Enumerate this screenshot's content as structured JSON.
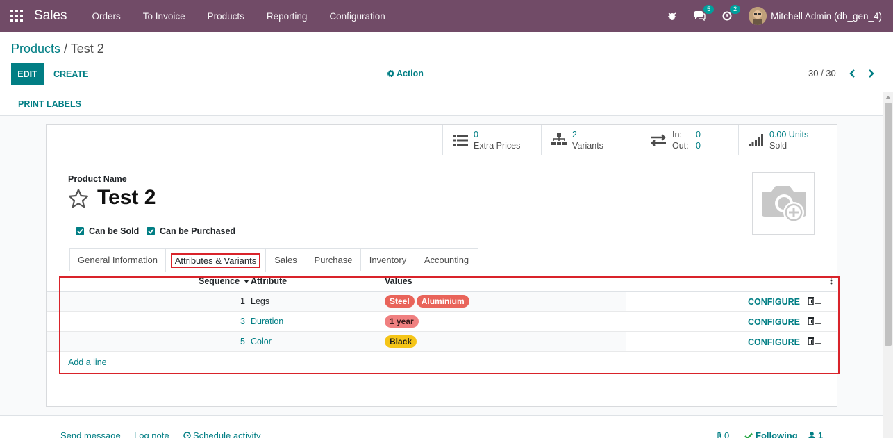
{
  "app": {
    "title": "Sales"
  },
  "menu": [
    "Orders",
    "To Invoice",
    "Products",
    "Reporting",
    "Configuration"
  ],
  "systray": {
    "messages_count": "5",
    "activities_count": "2",
    "user_name": "Mitchell Admin (db_gen_4)"
  },
  "breadcrumb": {
    "parent": "Products",
    "separator": " / ",
    "current": "Test 2"
  },
  "buttons": {
    "edit": "EDIT",
    "create": "CREATE",
    "action": "Action",
    "print_labels": "PRINT LABELS"
  },
  "pager": {
    "value": "30 / 30"
  },
  "stats": {
    "extra_prices": {
      "value": "0",
      "label": "Extra Prices"
    },
    "variants": {
      "value": "2",
      "label": "Variants"
    },
    "in_out": {
      "in_label": "In:",
      "in_value": "0",
      "out_label": "Out:",
      "out_value": "0"
    },
    "sold": {
      "value": "0.00 Units",
      "label": "Sold"
    }
  },
  "product": {
    "name_label": "Product Name",
    "name": "Test 2",
    "can_be_sold": "Can be Sold",
    "can_be_purchased": "Can be Purchased"
  },
  "tabs": [
    "General Information",
    "Attributes & Variants",
    "Sales",
    "Purchase",
    "Inventory",
    "Accounting"
  ],
  "active_tab": "Attributes & Variants",
  "table": {
    "headers": {
      "sequence": "Sequence",
      "attribute": "Attribute",
      "values": "Values"
    },
    "rows": [
      {
        "sequence": "1",
        "attribute": "Legs",
        "values": [
          {
            "label": "Steel",
            "color": "#e9645a"
          },
          {
            "label": "Aluminium",
            "color": "#e9645a"
          }
        ],
        "configure": "CONFIGURE"
      },
      {
        "sequence": "3",
        "attribute": "Duration",
        "values": [
          {
            "label": "1 year",
            "color": "#f08080"
          }
        ],
        "configure": "CONFIGURE"
      },
      {
        "sequence": "5",
        "attribute": "Color",
        "values": [
          {
            "label": "Black",
            "color": "#f5c518"
          }
        ],
        "configure": "CONFIGURE"
      }
    ],
    "add_line": "Add a line"
  },
  "chatter": {
    "send_message": "Send message",
    "log_note": "Log note",
    "schedule_activity": "Schedule activity",
    "attachments": "0",
    "following": "Following",
    "followers": "1"
  },
  "colors": {
    "brand": "#714b67",
    "accent": "#017e84",
    "highlight": "#d9232a"
  }
}
